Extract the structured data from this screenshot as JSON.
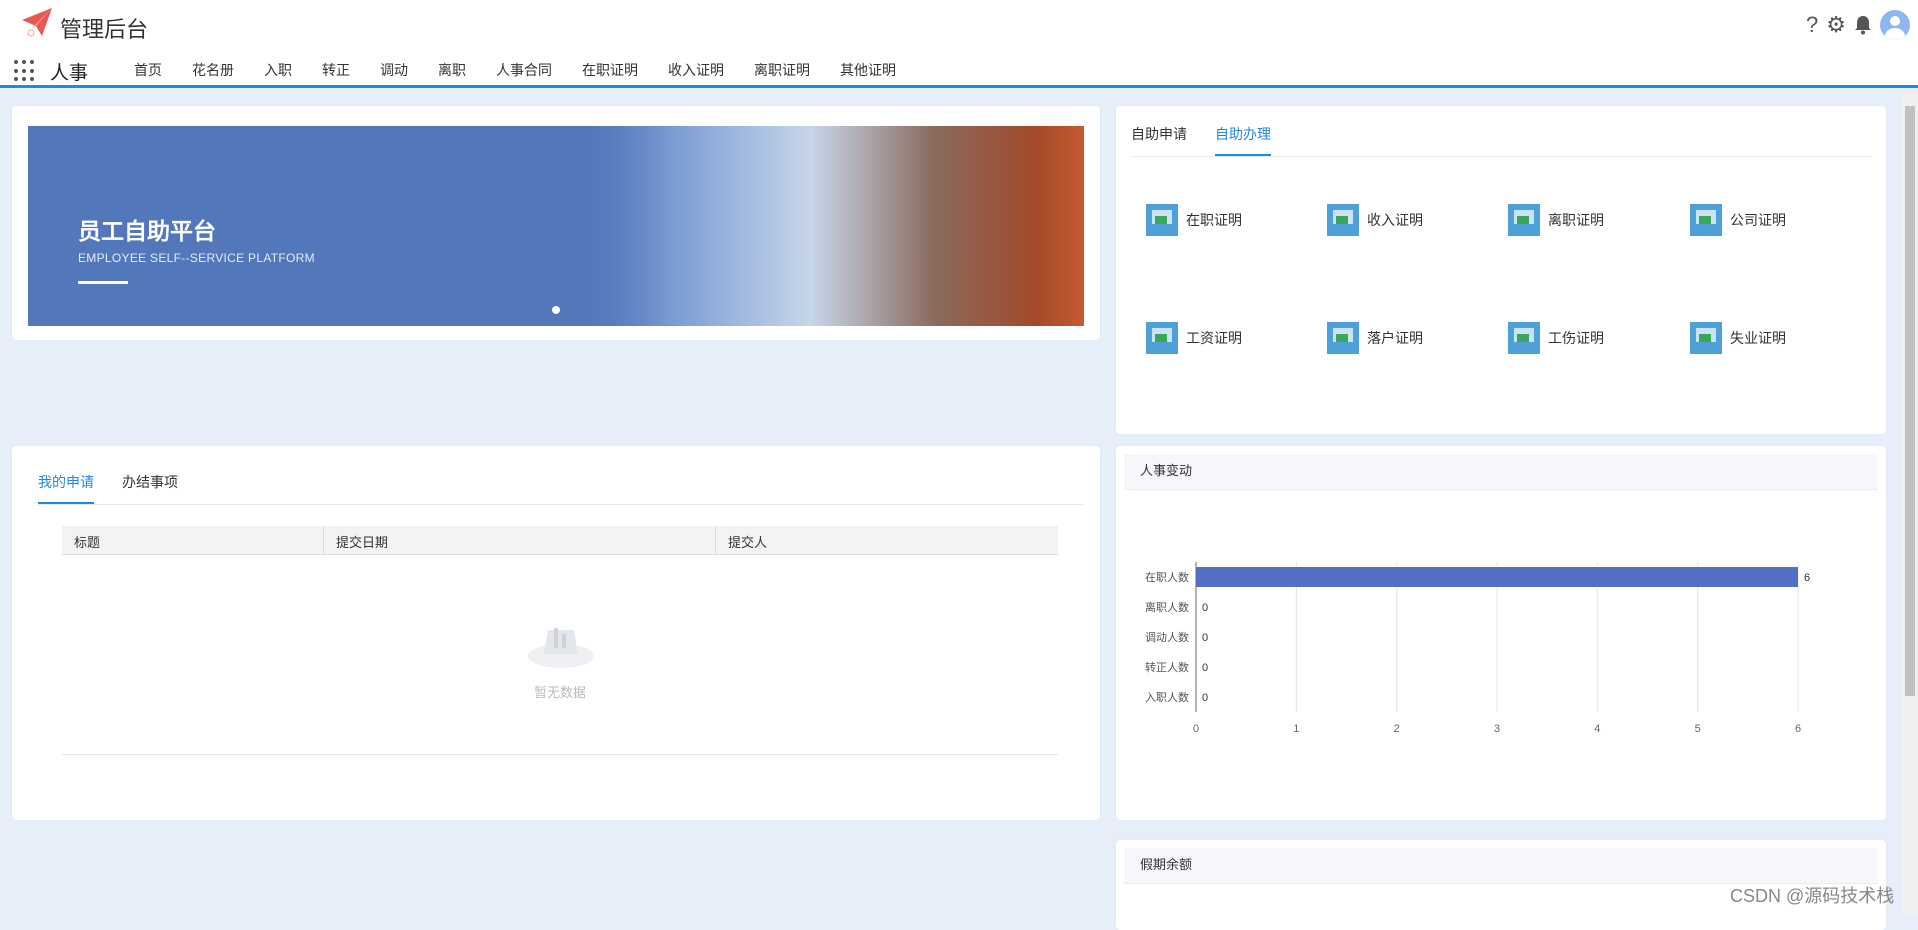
{
  "header": {
    "app_title": "管理后台",
    "module": "人事",
    "nav": [
      "首页",
      "花名册",
      "入职",
      "转正",
      "调动",
      "离职",
      "人事合同",
      "在职证明",
      "收入证明",
      "离职证明",
      "其他证明"
    ],
    "icons": [
      "help-icon",
      "settings-icon",
      "bell-icon",
      "avatar"
    ]
  },
  "banner": {
    "title": "员工自助平台",
    "subtitle": "EMPLOYEE SELF--SERVICE PLATFORM"
  },
  "selfservice": {
    "tabs": [
      "自助申请",
      "自助办理"
    ],
    "active_tab": "自助办理",
    "items": [
      "在职证明",
      "收入证明",
      "离职证明",
      "公司证明",
      "工资证明",
      "落户证明",
      "工伤证明",
      "失业证明"
    ]
  },
  "requests": {
    "tabs": [
      "我的申请",
      "办结事项"
    ],
    "active_tab": "我的申请",
    "columns": [
      "标题",
      "提交日期",
      "提交人"
    ],
    "empty_text": "暂无数据"
  },
  "hr_panel": {
    "title": "人事变动"
  },
  "leave_panel": {
    "title": "假期余额"
  },
  "chart_data": {
    "type": "bar",
    "orientation": "horizontal",
    "categories": [
      "在职人数",
      "离职人数",
      "调动人数",
      "转正人数",
      "入职人数"
    ],
    "values": [
      6,
      0,
      0,
      0,
      0
    ],
    "xlim": [
      0,
      6
    ],
    "xticks": [
      "0",
      "1",
      "2",
      "3",
      "4",
      "5",
      "6"
    ],
    "grid": "vertical",
    "bar_color": "#5470c6"
  },
  "colors": {
    "accent": "#1e88e5",
    "background": "#e6eef9"
  },
  "watermark": "CSDN @源码技术栈"
}
